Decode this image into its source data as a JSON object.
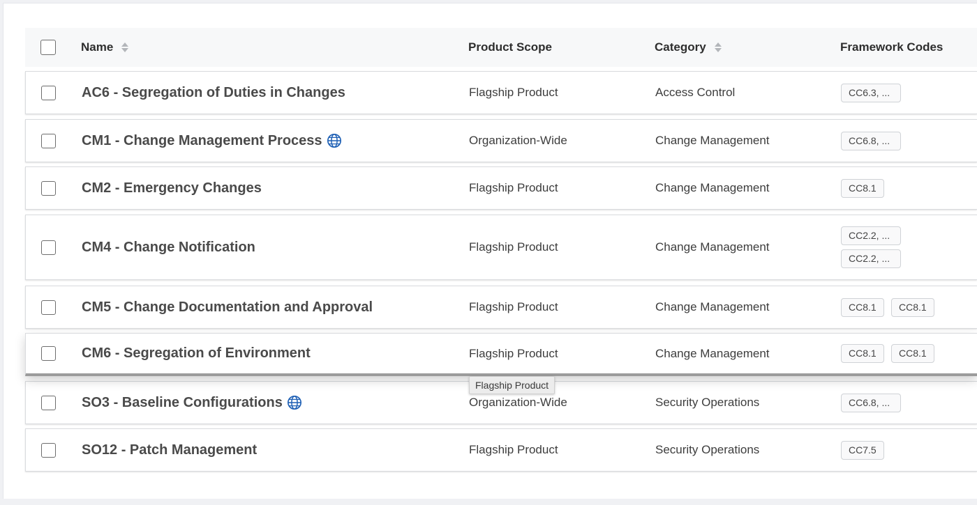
{
  "columns": {
    "name": "Name",
    "scope": "Product Scope",
    "category": "Category",
    "codes": "Framework Codes"
  },
  "rows": [
    {
      "name": "AC6 - Segregation of Duties in Changes",
      "globe": false,
      "scope": "Flagship Product",
      "category": "Access Control",
      "codes": [
        [
          "CC6.3, ..."
        ]
      ]
    },
    {
      "name": "CM1 - Change Management Process",
      "globe": true,
      "scope": "Organization-Wide",
      "category": "Change Management",
      "codes": [
        [
          "CC6.8, ..."
        ]
      ]
    },
    {
      "name": "CM2 - Emergency Changes",
      "globe": false,
      "scope": "Flagship Product",
      "category": "Change Management",
      "codes": [
        [
          "CC8.1"
        ]
      ]
    },
    {
      "name": "CM4 - Change Notification",
      "globe": false,
      "scope": "Flagship Product",
      "category": "Change Management",
      "codes": [
        [
          "CC2.2, ..."
        ],
        [
          "CC2.2, ..."
        ]
      ]
    },
    {
      "name": "CM5 - Change Documentation and Approval",
      "globe": false,
      "scope": "Flagship Product",
      "category": "Change Management",
      "codes": [
        [
          "CC8.1",
          "CC8.1"
        ]
      ]
    },
    {
      "name": "CM6 - Segregation of Environment",
      "globe": false,
      "scope": "Flagship Product",
      "category": "Change Management",
      "codes": [
        [
          "CC8.1",
          "CC8.1"
        ]
      ]
    },
    {
      "name": "SO3 - Baseline Configurations",
      "globe": true,
      "scope": "Organization-Wide",
      "category": "Security Operations",
      "codes": [
        [
          "CC6.8, ..."
        ]
      ]
    },
    {
      "name": "SO12 - Patch Management",
      "globe": false,
      "scope": "Flagship Product",
      "category": "Security Operations",
      "codes": [
        [
          "CC7.5"
        ]
      ]
    }
  ],
  "tooltip": "Flagship Product",
  "colors": {
    "globe": "#1d5fb4",
    "drag_bar": "#9b9b9b"
  }
}
